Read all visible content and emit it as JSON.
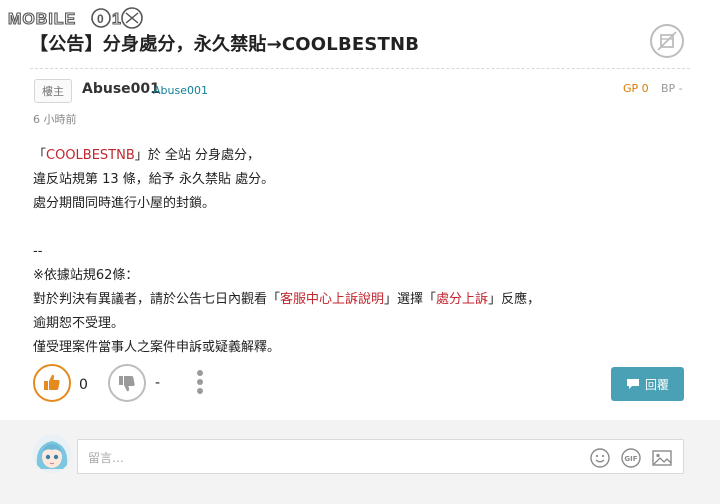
{
  "watermark": {
    "text": "MOBILE01"
  },
  "post": {
    "title": "【公告】分身處分，永久禁貼→COOLBESTNB",
    "badge": "樓主",
    "author": "Abuse001",
    "author_id": "Abuse001",
    "gp": "GP 0",
    "bp": "BP -",
    "time": "6 小時前",
    "content": {
      "l1_a": "「",
      "l1_red": "COOLBESTNB",
      "l1_b": "」於 全站 分身處分，",
      "l2": "違反站規第 13 條，給予 永久禁貼 處分。",
      "l3": "處分期間同時進行小屋的封鎖。",
      "l5": "--",
      "l6": "※依據站規62條：",
      "l7_a": "對於判決有異議者，請於公告七日內觀看「",
      "l7_red1": "客服中心上訴說明",
      "l7_b": "」選擇「",
      "l7_red2": "處分上訴",
      "l7_c": "」反應，",
      "l8": "逾期恕不受理。",
      "l9": "僅受理案件當事人之案件申訴或疑義解釋。"
    },
    "like_count": "0",
    "dislike_count": "-",
    "reply_label": "回覆"
  },
  "comment": {
    "placeholder": "留言…",
    "icons": [
      "smiley-icon",
      "gif-icon",
      "image-icon"
    ]
  },
  "colors": {
    "accent_orange": "#e58a1f",
    "reply_blue": "#4aa1b6",
    "red_text": "#c0262d",
    "author_id": "#117e96"
  }
}
